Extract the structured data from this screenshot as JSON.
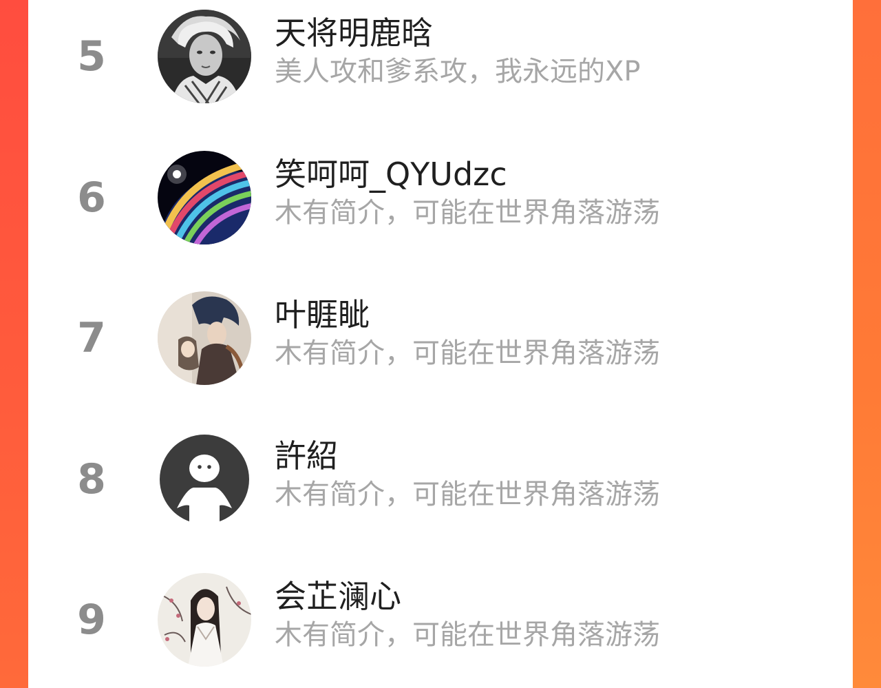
{
  "ranking": {
    "items": [
      {
        "rank": "5",
        "name": "天将明鹿晗",
        "bio": "美人攻和爹系攻，我永远的XP",
        "avatar_icon": "portrait-photo-avatar"
      },
      {
        "rank": "6",
        "name": "笑呵呵_QYUdzc",
        "bio": "木有简介，可能在世界角落游荡",
        "avatar_icon": "planet-avatar"
      },
      {
        "rank": "7",
        "name": "叶睚眦",
        "bio": "木有简介，可能在世界角落游荡",
        "avatar_icon": "anime-illustration-avatar"
      },
      {
        "rank": "8",
        "name": "許紹",
        "bio": "木有简介，可能在世界角落游荡",
        "avatar_icon": "default-user-avatar"
      },
      {
        "rank": "9",
        "name": "会芷澜心",
        "bio": "木有简介，可能在世界角落游荡",
        "avatar_icon": "ancient-style-illustration-avatar"
      }
    ]
  },
  "colors": {
    "accent_left": "#ff4d3f",
    "accent_right": "#ff8a3a",
    "rank_number": "#8c8c8c",
    "name_text": "#1f1f1f",
    "bio_text": "#a6a6a6"
  }
}
